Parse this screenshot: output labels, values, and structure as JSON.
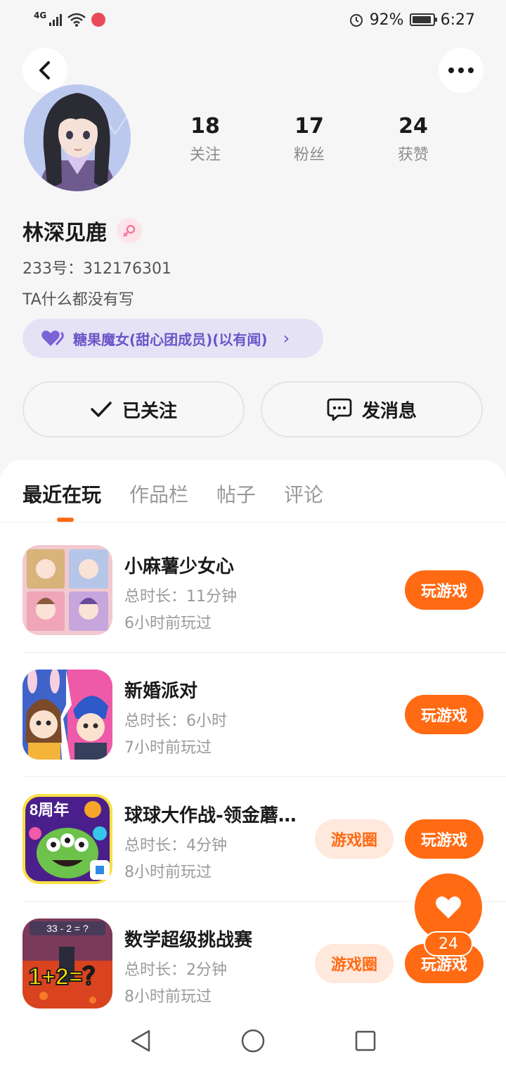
{
  "status_bar": {
    "network": "4G",
    "battery_percent": "92%",
    "time": "6:27"
  },
  "profile": {
    "name": "林深见鹿",
    "gender_icon": "female-icon",
    "uid": "233号：312176301",
    "bio": "TA什么都没有写",
    "badge_text": "糖果魔女(甜心团成员)(以有闻)",
    "stats": [
      {
        "value": "18",
        "label": "关注"
      },
      {
        "value": "17",
        "label": "粉丝"
      },
      {
        "value": "24",
        "label": "获赞"
      }
    ]
  },
  "actions": {
    "follow_label": "已关注",
    "message_label": "发消息"
  },
  "tabs": [
    {
      "label": "最近在玩",
      "active": true
    },
    {
      "label": "作品栏",
      "active": false
    },
    {
      "label": "帖子",
      "active": false
    },
    {
      "label": "评论",
      "active": false
    }
  ],
  "games": [
    {
      "title": "小麻薯少女心",
      "duration": "总时长：11分钟",
      "last_played": "6小时前玩过",
      "has_circle": false
    },
    {
      "title": "新婚派对",
      "duration": "总时长：6小时",
      "last_played": "7小时前玩过",
      "has_circle": false
    },
    {
      "title": "球球大作战-领金蘑…",
      "duration": "总时长：4分钟",
      "last_played": "8小时前玩过",
      "has_circle": true,
      "icon_text": "8周年"
    },
    {
      "title": "数学超级挑战赛",
      "duration": "总时长：2分钟",
      "last_played": "8小时前玩过",
      "has_circle": true,
      "icon_text_top": "33 - 2 = ?",
      "icon_text_main": "1+2=？"
    }
  ],
  "buttons": {
    "play_label": "玩游戏",
    "circle_label": "游戏圈"
  },
  "like": {
    "count": "24"
  },
  "colors": {
    "accent": "#ff6a13",
    "accent_soft": "#ffe8dc",
    "badge_bg": "#e6e2f6",
    "badge_text": "#6a55c7"
  }
}
